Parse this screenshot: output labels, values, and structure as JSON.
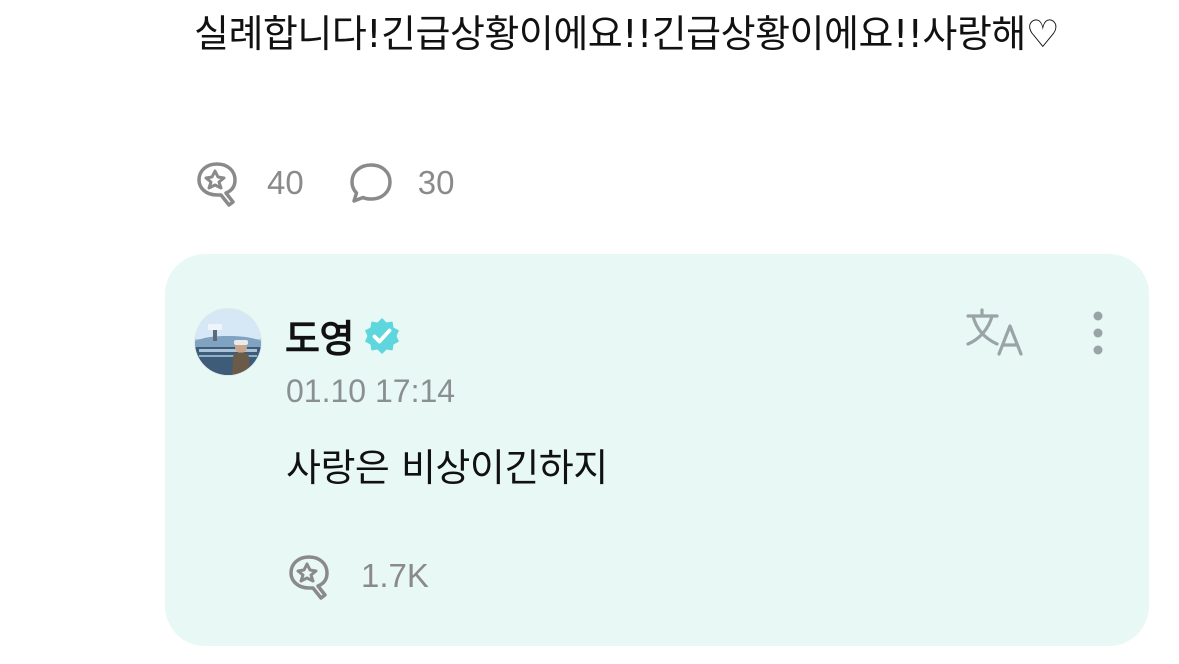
{
  "post": {
    "text": "실례합니다!긴급상황이에요!!긴급상황이에요!!사랑해♡",
    "actions": {
      "like_icon": "sparkle-bubble-icon",
      "like_count": "40",
      "comment_icon": "speech-bubble-icon",
      "comment_count": "30"
    }
  },
  "reply": {
    "author": "도영",
    "verified_icon": "verified-badge-icon",
    "timestamp": "01.10 17:14",
    "text": "사랑은 비상이긴하지",
    "translate_icon": "translate-icon",
    "more_icon": "more-vertical-icon",
    "like_icon": "sparkle-bubble-icon",
    "like_count": "1.7K"
  },
  "colors": {
    "card_background": "#e8f8f5",
    "verified_badge": "#5dd6dd",
    "muted_text": "#8a8a8a",
    "icon_gray": "#9aa4a6"
  }
}
